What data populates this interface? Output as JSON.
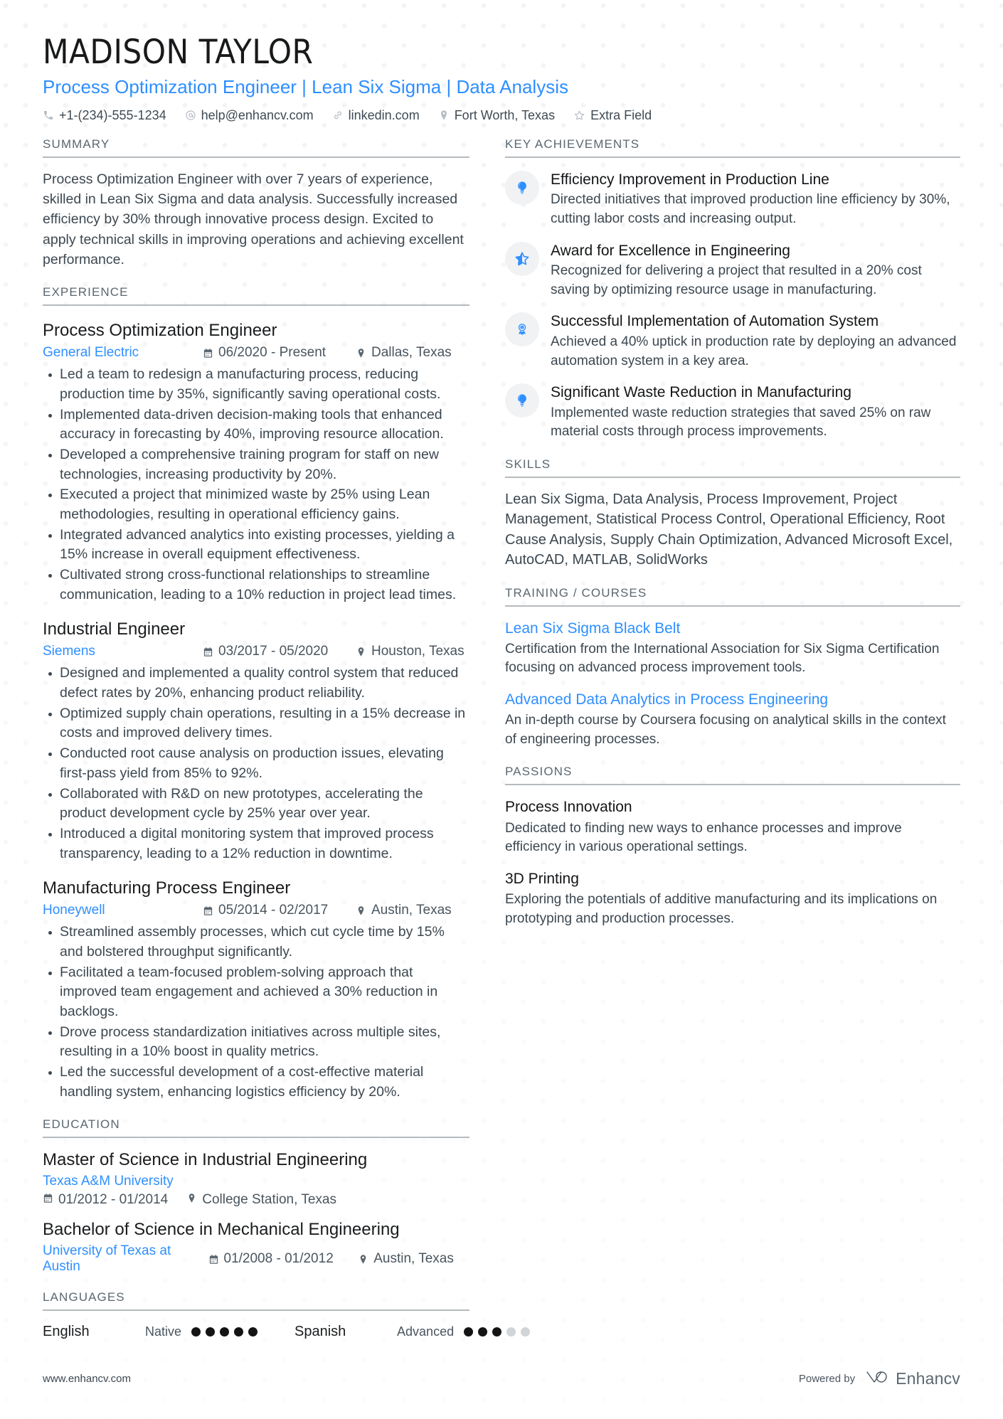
{
  "header": {
    "name": "MADISON TAYLOR",
    "headline": "Process Optimization Engineer | Lean Six Sigma | Data Analysis",
    "accent_color": "#2e8fff",
    "contacts": [
      {
        "icon": "phone-icon",
        "text": "+1-(234)-555-1234"
      },
      {
        "icon": "email-icon",
        "text": "help@enhancv.com"
      },
      {
        "icon": "link-icon",
        "text": "linkedin.com"
      },
      {
        "icon": "location-pin-icon",
        "text": "Fort Worth, Texas"
      },
      {
        "icon": "star-outline-icon",
        "text": "Extra Field"
      }
    ]
  },
  "left": {
    "summary": {
      "title": "SUMMARY",
      "text": "Process Optimization Engineer with over 7 years of experience, skilled in Lean Six Sigma and data analysis. Successfully increased efficiency by 30% through innovative process design. Excited to apply technical skills in improving operations and achieving excellent performance."
    },
    "experience": {
      "title": "EXPERIENCE",
      "jobs": [
        {
          "role": "Process Optimization Engineer",
          "company": "General Electric",
          "dates": "06/2020 - Present",
          "location": "Dallas, Texas",
          "bullets": [
            "Led a team to redesign a manufacturing process, reducing production time by 35%, significantly saving operational costs.",
            "Implemented data-driven decision-making tools that enhanced accuracy in forecasting by 40%, improving resource allocation.",
            "Developed a comprehensive training program for staff on new technologies, increasing productivity by 20%.",
            "Executed a project that minimized waste by 25% using Lean methodologies, resulting in operational efficiency gains.",
            "Integrated advanced analytics into existing processes, yielding a 15% increase in overall equipment effectiveness.",
            "Cultivated strong cross-functional relationships to streamline communication, leading to a 10% reduction in project lead times."
          ]
        },
        {
          "role": "Industrial Engineer",
          "company": "Siemens",
          "dates": "03/2017 - 05/2020",
          "location": "Houston, Texas",
          "bullets": [
            "Designed and implemented a quality control system that reduced defect rates by 20%, enhancing product reliability.",
            "Optimized supply chain operations, resulting in a 15% decrease in costs and improved delivery times.",
            "Conducted root cause analysis on production issues, elevating first-pass yield from 85% to 92%.",
            "Collaborated with R&D on new prototypes, accelerating the product development cycle by 25% year over year.",
            "Introduced a digital monitoring system that improved process transparency, leading to a 12% reduction in downtime."
          ]
        },
        {
          "role": "Manufacturing Process Engineer",
          "company": "Honeywell",
          "dates": "05/2014 - 02/2017",
          "location": "Austin, Texas",
          "bullets": [
            "Streamlined assembly processes, which cut cycle time by 15% and bolstered throughput significantly.",
            "Facilitated a team-focused problem-solving approach that improved team engagement and achieved a 30% reduction in backlogs.",
            "Drove process standardization initiatives across multiple sites, resulting in a 10% boost in quality metrics.",
            "Led the successful development of a cost-effective material handling system, enhancing logistics efficiency by 20%."
          ]
        }
      ]
    },
    "education": {
      "title": "EDUCATION",
      "entries": [
        {
          "degree": "Master of Science in Industrial Engineering",
          "school": "Texas A&M University",
          "dates": "01/2012 - 01/2014",
          "location": "College Station, Texas",
          "layout": "stacked"
        },
        {
          "degree": "Bachelor of Science in Mechanical Engineering",
          "school": "University of Texas at Austin",
          "dates": "01/2008 - 01/2012",
          "location": "Austin, Texas",
          "layout": "inline"
        }
      ]
    },
    "languages": {
      "title": "LANGUAGES",
      "items": [
        {
          "name": "English",
          "level": "Native",
          "filled": 5,
          "total": 5
        },
        {
          "name": "Spanish",
          "level": "Advanced",
          "filled": 3,
          "total": 5
        }
      ]
    }
  },
  "right": {
    "achievements": {
      "title": "KEY ACHIEVEMENTS",
      "items": [
        {
          "icon": "lightbulb-icon",
          "title": "Efficiency Improvement in Production Line",
          "desc": "Directed initiatives that improved production line efficiency by 30%, cutting labor costs and increasing output."
        },
        {
          "icon": "star-half-icon",
          "title": "Award for Excellence in Engineering",
          "desc": "Recognized for delivering a project that resulted in a 20% cost saving by optimizing resource usage in manufacturing."
        },
        {
          "icon": "award-medal-icon",
          "title": "Successful Implementation of Automation System",
          "desc": "Achieved a 40% uptick in production rate by deploying an advanced automation system in a key area."
        },
        {
          "icon": "lightbulb-icon",
          "title": "Significant Waste Reduction in Manufacturing",
          "desc": "Implemented waste reduction strategies that saved 25% on raw material costs through process improvements."
        }
      ]
    },
    "skills": {
      "title": "SKILLS",
      "text": "Lean Six Sigma, Data Analysis, Process Improvement, Project Management, Statistical Process Control, Operational Efficiency, Root Cause Analysis, Supply Chain Optimization, Advanced Microsoft Excel, AutoCAD, MATLAB, SolidWorks"
    },
    "training": {
      "title": "TRAINING / COURSES",
      "items": [
        {
          "name": "Lean Six Sigma Black Belt",
          "desc": "Certification from the International Association for Six Sigma Certification focusing on advanced process improvement tools."
        },
        {
          "name": "Advanced Data Analytics in Process Engineering",
          "desc": "An in-depth course by Coursera focusing on analytical skills in the context of engineering processes."
        }
      ]
    },
    "passions": {
      "title": "PASSIONS",
      "items": [
        {
          "name": "Process Innovation",
          "desc": "Dedicated to finding new ways to enhance processes and improve efficiency in various operational settings."
        },
        {
          "name": "3D Printing",
          "desc": "Exploring the potentials of additive manufacturing and its implications on prototyping and production processes."
        }
      ]
    }
  },
  "footer": {
    "url": "www.enhancv.com",
    "powered_by": "Powered by",
    "brand": "Enhancv",
    "brand_icon": "enhancv-logo-icon"
  }
}
